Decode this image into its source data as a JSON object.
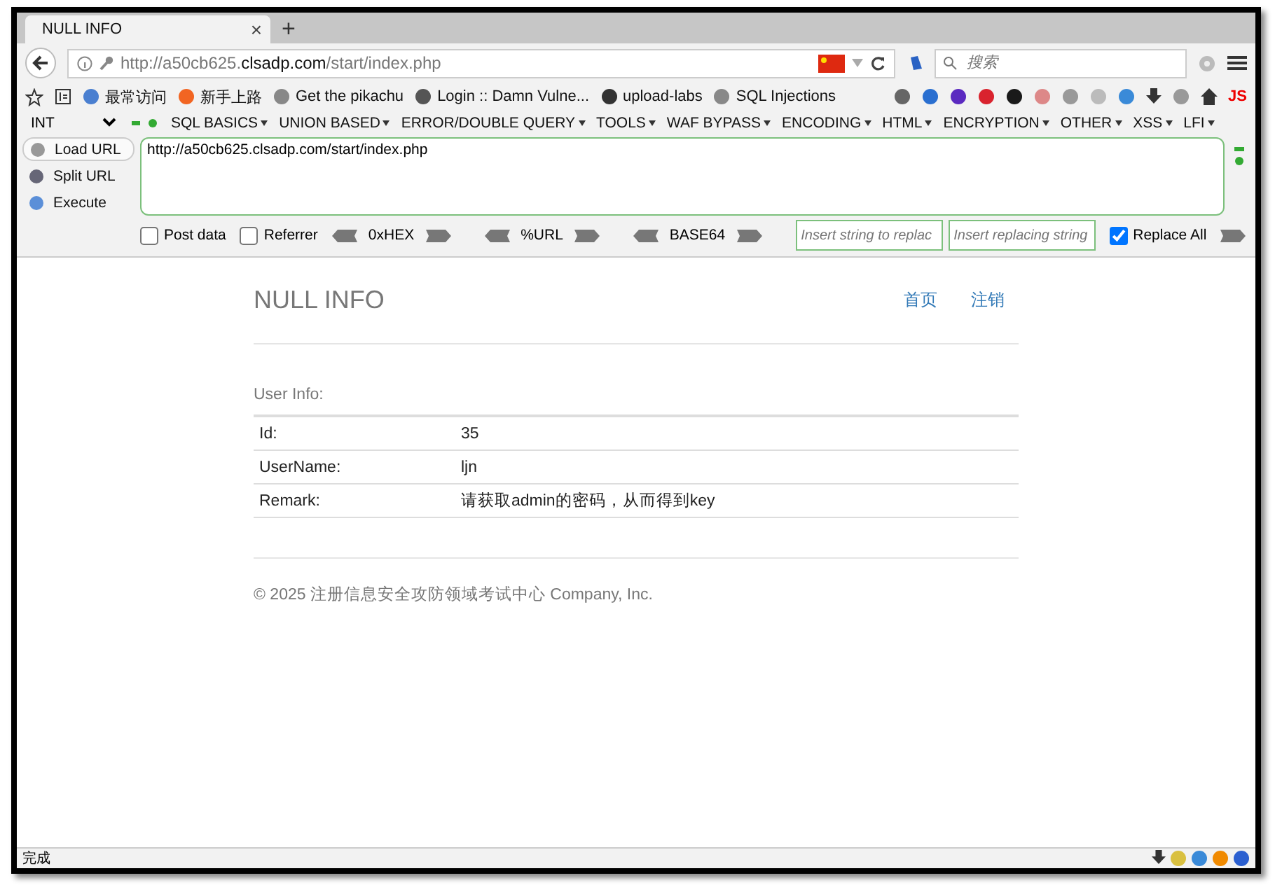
{
  "tab": {
    "title": "NULL INFO",
    "close": "×",
    "new": "+"
  },
  "address": {
    "url_prefix": "http://a50cb625.",
    "url_domain": "clsadp.com",
    "url_path": "/start/index.php"
  },
  "search": {
    "placeholder": "搜索"
  },
  "bookmarks": [
    {
      "label": "最常访问"
    },
    {
      "label": "新手上路"
    },
    {
      "label": "Get the pikachu"
    },
    {
      "label": "Login :: Damn Vulne..."
    },
    {
      "label": "upload-labs"
    },
    {
      "label": "SQL Injections"
    }
  ],
  "toolbar_badge": "JS",
  "hackbar": {
    "type_select": "INT",
    "menus": [
      "SQL BASICS",
      "UNION BASED",
      "ERROR/DOUBLE QUERY",
      "TOOLS",
      "WAF BYPASS",
      "ENCODING",
      "HTML",
      "ENCRYPTION",
      "OTHER",
      "XSS",
      "LFI"
    ],
    "actions": [
      {
        "label": "Load URL"
      },
      {
        "label": "Split URL"
      },
      {
        "label": "Execute"
      }
    ],
    "url": "http://a50cb625.clsadp.com/start/index.php",
    "options": [
      {
        "label": "Post data",
        "checked": false
      },
      {
        "label": "Referrer",
        "checked": false
      }
    ],
    "encoders": [
      "0xHEX",
      "%URL",
      "BASE64"
    ],
    "replace_from": {
      "placeholder": "Insert string to replac"
    },
    "replace_to": {
      "placeholder": "Insert replacing string"
    },
    "replace_all": {
      "label": "Replace All",
      "checked": true
    }
  },
  "page": {
    "brand": "NULL INFO",
    "nav": [
      "首页",
      "注销"
    ],
    "section": "User Info:",
    "rows": [
      {
        "label": "Id:",
        "value": "35"
      },
      {
        "label": "UserName:",
        "value": "ljn"
      },
      {
        "label": "Remark:",
        "value": "请获取admin的密码，从而得到key"
      }
    ],
    "footer": "© 2025 注册信息安全攻防领域考试中心 Company, Inc."
  },
  "status_bar": "完成"
}
